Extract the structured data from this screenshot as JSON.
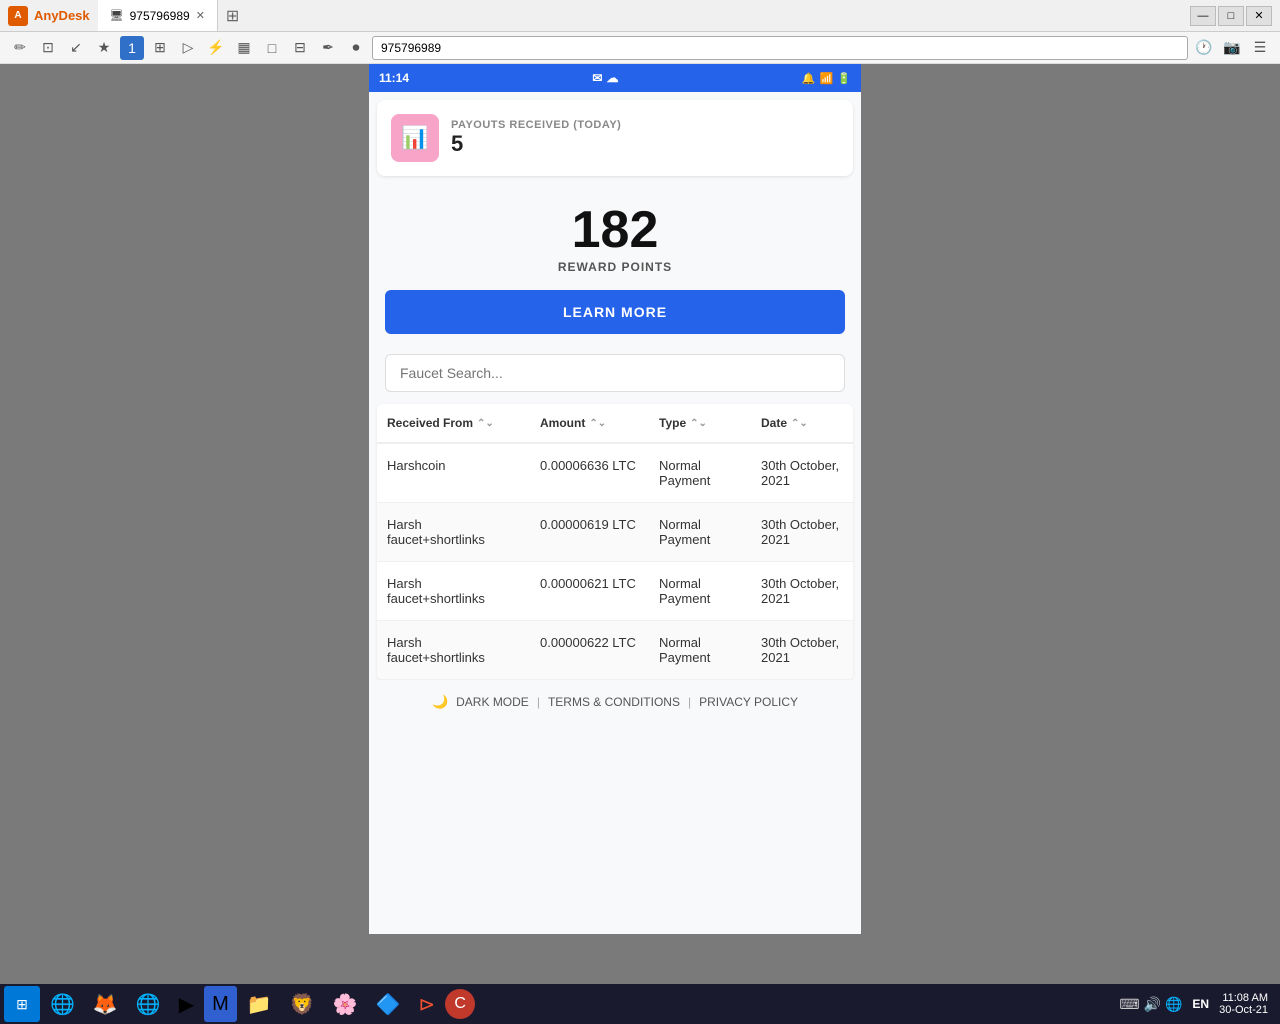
{
  "anydesk": {
    "title": "AnyDesk",
    "tab_id": "975796989",
    "address": "975796989"
  },
  "toolbar_icons": [
    "✏",
    "⊡",
    "↙",
    "★",
    "1",
    "⊞",
    "▷",
    "⚡",
    "▦",
    "□",
    "⊟",
    "✒",
    "▶"
  ],
  "phone": {
    "status_bar": {
      "time": "11:14",
      "icons_left": [
        "✉",
        "☁"
      ],
      "icons_right": [
        "🔔",
        "📶",
        "🔋"
      ]
    },
    "payouts": {
      "label": "PAYOUTS RECEIVED (TODAY)",
      "count": "5",
      "icon": "📊"
    },
    "reward": {
      "points": "182",
      "label": "REWARD POINTS",
      "button_label": "LEARN MORE"
    },
    "search": {
      "placeholder": "Faucet Search..."
    },
    "table": {
      "headers": [
        {
          "label": "Received From",
          "sortable": true
        },
        {
          "label": "Amount",
          "sortable": true
        },
        {
          "label": "Type",
          "sortable": true
        },
        {
          "label": "Date",
          "sortable": true
        }
      ],
      "rows": [
        {
          "from": "Harshcoin",
          "amount": "0.00006636 LTC",
          "type": "Normal Payment",
          "date": "30th October, 2021"
        },
        {
          "from": "Harsh faucet+shortlinks",
          "amount": "0.00000619 LTC",
          "type": "Normal Payment",
          "date": "30th October, 2021"
        },
        {
          "from": "Harsh faucet+shortlinks",
          "amount": "0.00000621 LTC",
          "type": "Normal Payment",
          "date": "30th October, 2021"
        },
        {
          "from": "Harsh faucet+shortlinks",
          "amount": "0.00000622 LTC",
          "type": "Normal Payment",
          "date": "30th October, 2021"
        }
      ]
    },
    "footer": {
      "dark_mode": "DARK MODE",
      "terms": "TERMS & CONDITIONS",
      "privacy": "PRIVACY POLICY"
    }
  },
  "taskbar": {
    "time": "11:08 AM",
    "date": "30-Oct-21",
    "language": "EN"
  }
}
